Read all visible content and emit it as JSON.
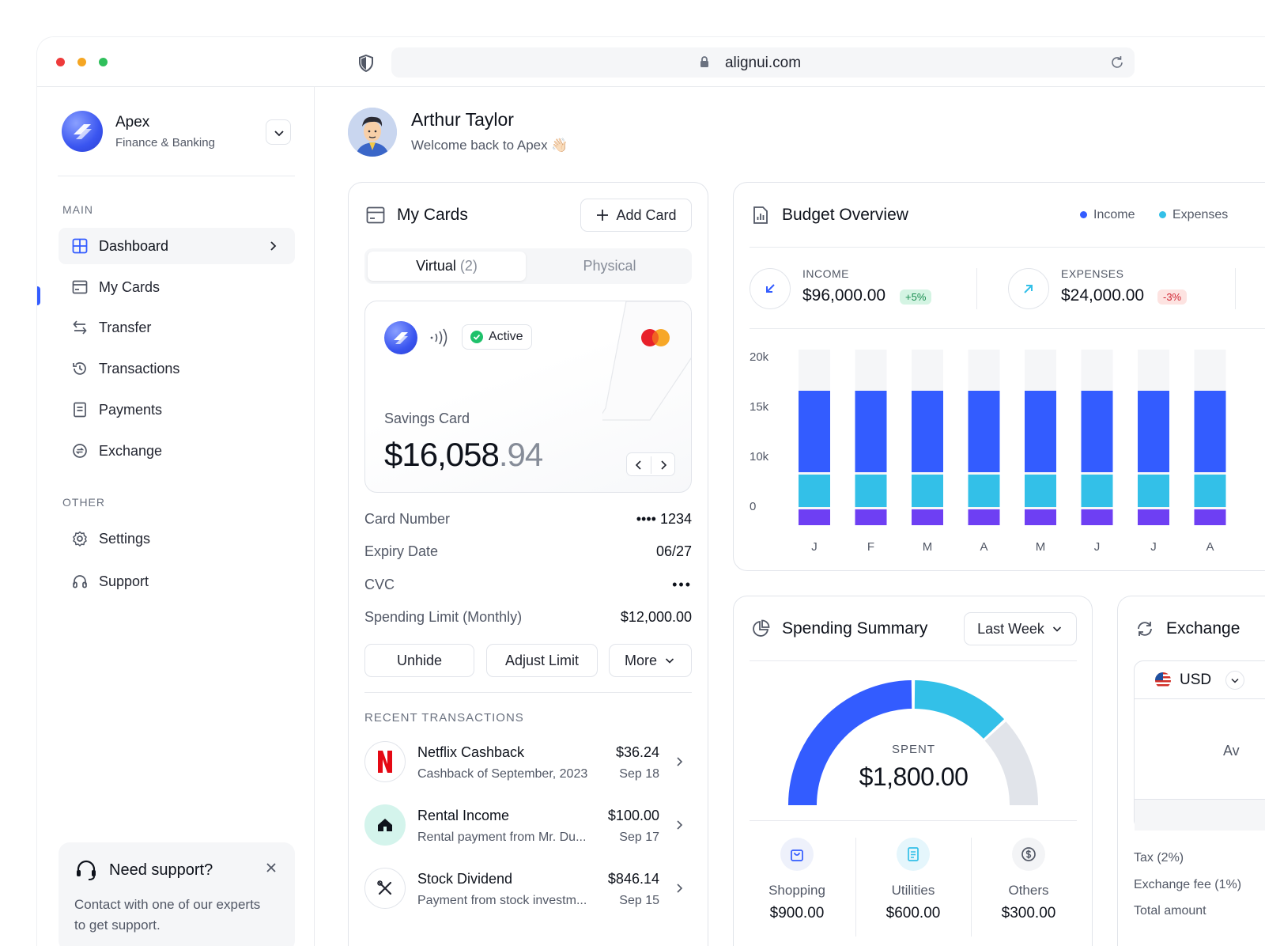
{
  "browser": {
    "url": "alignui.com"
  },
  "brand": {
    "name": "Apex",
    "subtitle": "Finance & Banking"
  },
  "sidebar": {
    "main_label": "MAIN",
    "other_label": "OTHER",
    "items": [
      {
        "label": "Dashboard",
        "icon": "grid-icon"
      },
      {
        "label": "My Cards",
        "icon": "card-icon"
      },
      {
        "label": "Transfer",
        "icon": "arrows-swap-icon"
      },
      {
        "label": "Transactions",
        "icon": "history-icon"
      },
      {
        "label": "Payments",
        "icon": "document-icon"
      },
      {
        "label": "Exchange",
        "icon": "currency-exchange-icon"
      }
    ],
    "other_items": [
      {
        "label": "Settings",
        "icon": "gear-icon"
      },
      {
        "label": "Support",
        "icon": "headphones-icon"
      }
    ],
    "support_box": {
      "title": "Need support?",
      "text": "Contact with one of our experts to get support."
    }
  },
  "user": {
    "name": "Arthur Taylor",
    "welcome": "Welcome back to Apex 👋🏻"
  },
  "my_cards": {
    "title": "My Cards",
    "add_button": "Add Card",
    "tabs": {
      "virtual": "Virtual",
      "virtual_count": "(2)",
      "physical": "Physical"
    },
    "card": {
      "status": "Active",
      "name": "Savings Card",
      "balance_main": "$16,058",
      "balance_cents": ".94"
    },
    "details": [
      {
        "label": "Card Number",
        "value": "•••• 1234"
      },
      {
        "label": "Expiry Date",
        "value": "06/27"
      },
      {
        "label": "CVC",
        "value": "•••"
      },
      {
        "label": "Spending Limit (Monthly)",
        "value": "$12,000.00"
      }
    ],
    "actions": {
      "unhide": "Unhide",
      "adjust": "Adjust Limit",
      "more": "More"
    },
    "recent_label": "RECENT TRANSACTIONS",
    "transactions": [
      {
        "title": "Netflix Cashback",
        "sub": "Cashback of September, 2023",
        "amount": "$36.24",
        "date": "Sep 18",
        "icon": "netflix-icon"
      },
      {
        "title": "Rental Income",
        "sub": "Rental payment from Mr. Du...",
        "amount": "$100.00",
        "date": "Sep 17",
        "icon": "home-icon"
      },
      {
        "title": "Stock Dividend",
        "sub": "Payment from stock investm...",
        "amount": "$846.14",
        "date": "Sep 15",
        "icon": "tools-icon"
      }
    ]
  },
  "budget": {
    "title": "Budget Overview",
    "legend": {
      "income": "Income",
      "expenses": "Expenses"
    },
    "income": {
      "label": "INCOME",
      "value": "$96,000.00",
      "change": "+5%"
    },
    "expenses": {
      "label": "EXPENSES",
      "value": "$24,000.00",
      "change": "-3%"
    },
    "colors": {
      "income": "#335cff",
      "expenses": "#33c0e8",
      "other": "#6e3ff3",
      "track": "#f5f6f8"
    }
  },
  "chart_data": {
    "type": "bar",
    "categories": [
      "J",
      "F",
      "M",
      "A",
      "M",
      "J",
      "J",
      "A"
    ],
    "y_ticks": [
      "20k",
      "15k",
      "10k",
      "0"
    ],
    "series": [
      {
        "name": "Income",
        "values": [
          8000,
          8000,
          8000,
          8000,
          8000,
          8000,
          8000,
          8000
        ]
      },
      {
        "name": "Expenses",
        "values": [
          3000,
          3000,
          3000,
          3000,
          3000,
          3000,
          3000,
          3000
        ]
      }
    ]
  },
  "spending": {
    "title": "Spending Summary",
    "period": "Last Week",
    "spent_label": "SPENT",
    "spent_value": "$1,800.00",
    "categories": [
      {
        "name": "Shopping",
        "value": "$900.00",
        "icon": "shopping-bag-icon"
      },
      {
        "name": "Utilities",
        "value": "$600.00",
        "icon": "receipt-icon"
      },
      {
        "name": "Others",
        "value": "$300.00",
        "icon": "coin-icon"
      }
    ]
  },
  "exchange": {
    "title": "Exchange",
    "currency": "USD",
    "partial_text": "Av",
    "rows": [
      "Tax (2%)",
      "Exchange fee (1%)",
      "Total amount"
    ]
  }
}
